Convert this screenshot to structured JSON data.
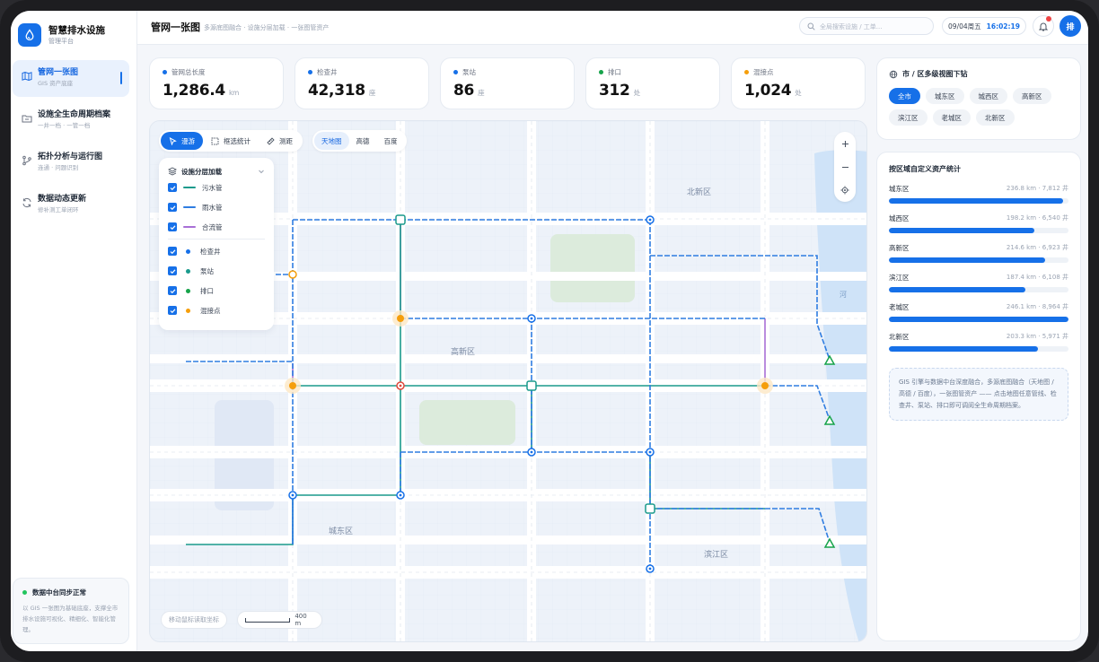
{
  "brand": {
    "title": "智慧排水设施",
    "subtitle": "管理平台"
  },
  "nav": [
    {
      "label": "管网一张图",
      "sub": "GIS 资产底座",
      "active": true
    },
    {
      "label": "设施全生命周期档案",
      "sub": "一井一档 · 一管一档",
      "active": false
    },
    {
      "label": "拓扑分析与运行图",
      "sub": "连通 · 问题识别",
      "active": false
    },
    {
      "label": "数据动态更新",
      "sub": "修补测工单闭环",
      "active": false
    }
  ],
  "sync": {
    "title": "数据中台同步正常",
    "text": "以 GIS 一张图为基础底座，支撑全市排水设施可视化、精细化、智能化管理。"
  },
  "header": {
    "title": "管网一张图",
    "breadcrumb": "多源底图融合 · 设施分层加载 · 一张图管资产",
    "search_placeholder": "全局搜索设施 / 工单...",
    "date": "09/04周五",
    "time": "16:02:19",
    "avatar": "排"
  },
  "stats": [
    {
      "label": "管网总长度",
      "value": "1,286.4",
      "unit": "km",
      "color": "#1670e8"
    },
    {
      "label": "检查井",
      "value": "42,318",
      "unit": "座",
      "color": "#1670e8"
    },
    {
      "label": "泵站",
      "value": "86",
      "unit": "座",
      "color": "#1670e8"
    },
    {
      "label": "排口",
      "value": "312",
      "unit": "处",
      "color": "#16a34a"
    },
    {
      "label": "混接点",
      "value": "1,024",
      "unit": "处",
      "color": "#f59e0b"
    }
  ],
  "map": {
    "tools": [
      {
        "label": "漫游",
        "icon": "cursor-icon",
        "active": true
      },
      {
        "label": "框选统计",
        "icon": "select-box-icon",
        "active": false
      },
      {
        "label": "测距",
        "icon": "ruler-icon",
        "active": false
      }
    ],
    "basemaps": [
      {
        "label": "天地图",
        "active": true
      },
      {
        "label": "高德",
        "active": false
      },
      {
        "label": "百度",
        "active": false
      }
    ],
    "layers_title": "设施分层加载",
    "pipe_layers": [
      {
        "label": "污水管",
        "color": "#1a9a8c"
      },
      {
        "label": "雨水管",
        "color": "#2f7de1"
      },
      {
        "label": "合流管",
        "color": "#a86fd6"
      }
    ],
    "point_layers": [
      {
        "label": "检查井",
        "color": "#1670e8"
      },
      {
        "label": "泵站",
        "color": "#1a9a8c"
      },
      {
        "label": "排口",
        "color": "#16a34a"
      },
      {
        "label": "混接点",
        "color": "#f59e0b"
      }
    ],
    "districts": [
      "北新区",
      "高新区",
      "城东区",
      "滨江区"
    ],
    "river_label": "河",
    "coord_hint": "移动鼠标读取坐标",
    "scale_label": "400 m"
  },
  "drilldown": {
    "title": "市 / 区多级视图下钻",
    "chips": [
      {
        "label": "全市",
        "active": true
      },
      {
        "label": "城东区",
        "active": false
      },
      {
        "label": "城西区",
        "active": false
      },
      {
        "label": "高新区",
        "active": false
      },
      {
        "label": "滨江区",
        "active": false
      },
      {
        "label": "老城区",
        "active": false
      },
      {
        "label": "北新区",
        "active": false
      }
    ]
  },
  "district_stats": {
    "title": "按区域自定义资产统计",
    "rows": [
      {
        "name": "城东区",
        "stat": "236.8 km · 7,812 井",
        "share": 0.97
      },
      {
        "name": "城西区",
        "stat": "198.2 km · 6,540 井",
        "share": 0.81
      },
      {
        "name": "高新区",
        "stat": "214.6 km · 6,923 井",
        "share": 0.87
      },
      {
        "name": "滨江区",
        "stat": "187.4 km · 6,108 井",
        "share": 0.76
      },
      {
        "name": "老城区",
        "stat": "246.1 km · 8,964 井",
        "share": 1.0
      },
      {
        "name": "北新区",
        "stat": "203.3 km · 5,971 井",
        "share": 0.83
      }
    ],
    "note": "GIS 引擎与数据中台深度融合，多源底图融合（天地图 / 高德 / 百度），一张图管资产 —— 点击地图任意管线、检查井、泵站、排口即可调阅全生命周期档案。"
  }
}
